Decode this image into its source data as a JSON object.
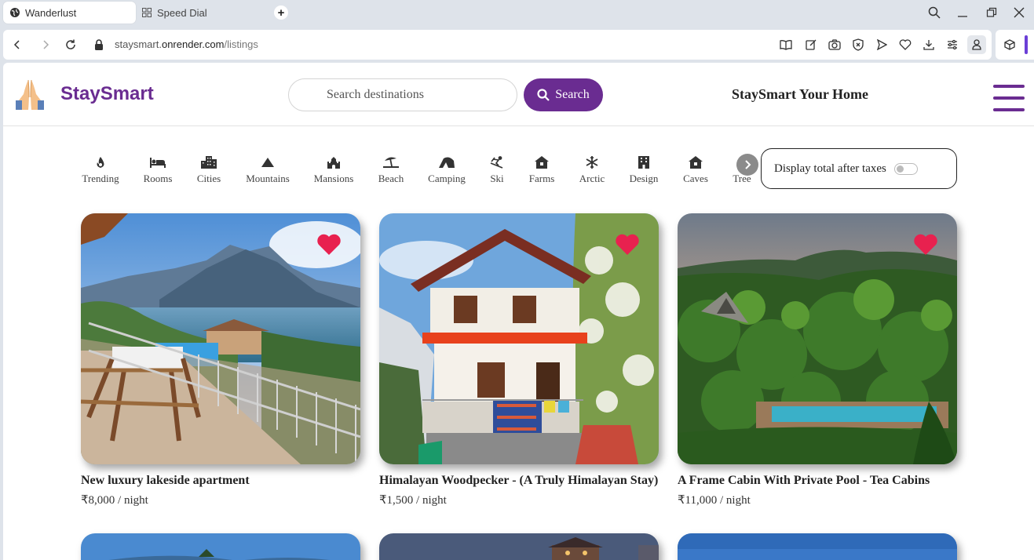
{
  "browser": {
    "tabs": [
      {
        "label": "Wanderlust",
        "icon": "globe-icon",
        "active": true
      },
      {
        "label": "Speed Dial",
        "icon": "grid-icon",
        "active": false
      }
    ],
    "url_host_prefix": "staysmart.",
    "url_host": "onrender.com",
    "url_path": "/listings"
  },
  "header": {
    "brand": "StaySmart",
    "search_placeholder": "Search destinations",
    "search_button": "Search",
    "tagline": "StaySmart Your Home"
  },
  "filters": [
    {
      "label": "Trending",
      "icon": "fire-icon"
    },
    {
      "label": "Rooms",
      "icon": "bed-icon"
    },
    {
      "label": "Cities",
      "icon": "city-icon"
    },
    {
      "label": "Mountains",
      "icon": "mountain-icon"
    },
    {
      "label": "Mansions",
      "icon": "castle-icon"
    },
    {
      "label": "Beach",
      "icon": "umbrella-beach-icon"
    },
    {
      "label": "Camping",
      "icon": "tent-icon"
    },
    {
      "label": "Ski",
      "icon": "skiing-icon"
    },
    {
      "label": "Farms",
      "icon": "house-icon"
    },
    {
      "label": "Arctic",
      "icon": "snowflake-icon"
    },
    {
      "label": "Design",
      "icon": "building-icon"
    },
    {
      "label": "Caves",
      "icon": "house-icon"
    },
    {
      "label": "Tree",
      "icon": "tree-icon"
    }
  ],
  "tax_toggle": {
    "label": "Display total after taxes",
    "on": false
  },
  "listings": [
    {
      "title": "New luxury lakeside apartment",
      "price": "₹8,000",
      "per": " / night"
    },
    {
      "title": "Himalayan Woodpecker - (A Truly Himalayan Stay)",
      "price": "₹1,500",
      "per": " / night"
    },
    {
      "title": "A Frame Cabin With Private Pool - Tea Cabins",
      "price": "₹11,000",
      "per": " / night"
    }
  ],
  "colors": {
    "brand": "#6a2c91",
    "heart": "#e8214f"
  }
}
